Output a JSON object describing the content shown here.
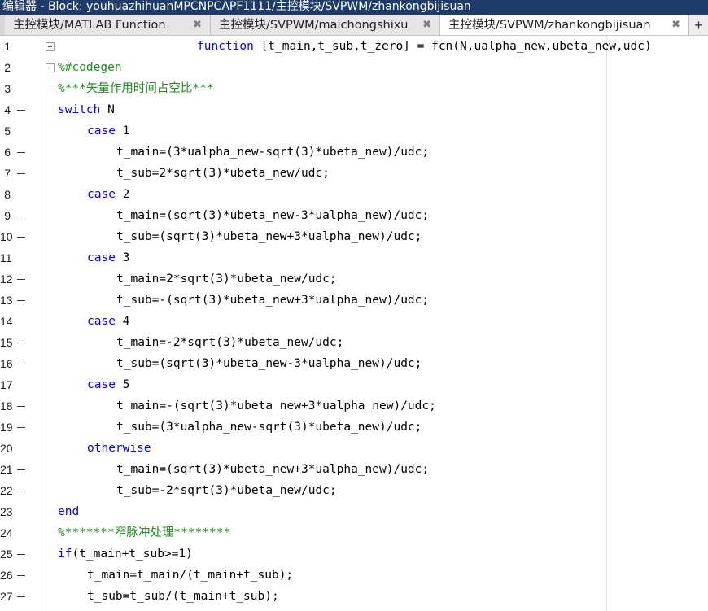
{
  "window": {
    "title": "编辑器 - Block: youhuazhihuanMPCNPCAPF1111/主控模块/SVPWM/zhankongbijisuan"
  },
  "tabs": [
    {
      "label": "主控模块/MATLAB Function",
      "close": "✖",
      "active": false
    },
    {
      "label": "主控模块/SVPWM/maichongshixu",
      "close": "✖",
      "active": false
    },
    {
      "label": "主控模块/SVPWM/zhankongbijisuan",
      "close": "✖",
      "active": true
    }
  ],
  "tab_add": "+",
  "colors": {
    "keyword": "#0000ff",
    "comment": "#228b22",
    "text": "#000000",
    "titlebar": "#1f3b6a"
  },
  "lines": [
    {
      "n": "1",
      "indent": 19,
      "dash": false,
      "fold": true,
      "parts": [
        {
          "t": "function",
          "c": "kw"
        },
        {
          "t": " [t_main,t_sub,t_zero] = fcn(N,ualpha_new,ubeta_new,udc)",
          "c": ""
        }
      ]
    },
    {
      "n": "2",
      "indent": 0,
      "dash": false,
      "fold": true,
      "parts": [
        {
          "t": "%#codegen",
          "c": "cm"
        }
      ]
    },
    {
      "n": "3",
      "indent": 0,
      "dash": false,
      "fold": false,
      "tick": true,
      "parts": [
        {
          "t": "%***矢量作用时间占空比***",
          "c": "cm"
        }
      ]
    },
    {
      "n": "4",
      "indent": 0,
      "dash": true,
      "fold": false,
      "parts": [
        {
          "t": "switch",
          "c": "kw"
        },
        {
          "t": " N",
          "c": ""
        }
      ]
    },
    {
      "n": "5",
      "indent": 4,
      "dash": false,
      "fold": false,
      "parts": [
        {
          "t": "case",
          "c": "kw"
        },
        {
          "t": " 1",
          "c": ""
        }
      ]
    },
    {
      "n": "6",
      "indent": 8,
      "dash": true,
      "fold": false,
      "parts": [
        {
          "t": "t_main=(3*ualpha_new-sqrt(3)*ubeta_new)/udc;",
          "c": ""
        }
      ]
    },
    {
      "n": "7",
      "indent": 8,
      "dash": true,
      "fold": false,
      "parts": [
        {
          "t": "t_sub=2*sqrt(3)*ubeta_new/udc;",
          "c": ""
        }
      ]
    },
    {
      "n": "8",
      "indent": 4,
      "dash": false,
      "fold": false,
      "parts": [
        {
          "t": "case",
          "c": "kw"
        },
        {
          "t": " 2",
          "c": ""
        }
      ]
    },
    {
      "n": "9",
      "indent": 8,
      "dash": true,
      "fold": false,
      "parts": [
        {
          "t": "t_main=(sqrt(3)*ubeta_new-3*ualpha_new)/udc;",
          "c": ""
        }
      ]
    },
    {
      "n": "10",
      "indent": 8,
      "dash": true,
      "fold": false,
      "parts": [
        {
          "t": "t_sub=(sqrt(3)*ubeta_new+3*ualpha_new)/udc;",
          "c": ""
        }
      ]
    },
    {
      "n": "11",
      "indent": 4,
      "dash": false,
      "fold": false,
      "parts": [
        {
          "t": "case",
          "c": "kw"
        },
        {
          "t": " 3",
          "c": ""
        }
      ]
    },
    {
      "n": "12",
      "indent": 8,
      "dash": true,
      "fold": false,
      "parts": [
        {
          "t": "t_main=2*sqrt(3)*ubeta_new/udc;",
          "c": ""
        }
      ]
    },
    {
      "n": "13",
      "indent": 8,
      "dash": true,
      "fold": false,
      "parts": [
        {
          "t": "t_sub=-(sqrt(3)*ubeta_new+3*ualpha_new)/udc;",
          "c": ""
        }
      ]
    },
    {
      "n": "14",
      "indent": 4,
      "dash": false,
      "fold": false,
      "parts": [
        {
          "t": "case",
          "c": "kw"
        },
        {
          "t": " 4",
          "c": ""
        }
      ]
    },
    {
      "n": "15",
      "indent": 8,
      "dash": true,
      "fold": false,
      "parts": [
        {
          "t": "t_main=-2*sqrt(3)*ubeta_new/udc;",
          "c": ""
        }
      ]
    },
    {
      "n": "16",
      "indent": 8,
      "dash": true,
      "fold": false,
      "parts": [
        {
          "t": "t_sub=(sqrt(3)*ubeta_new-3*ualpha_new)/udc;",
          "c": ""
        }
      ]
    },
    {
      "n": "17",
      "indent": 4,
      "dash": false,
      "fold": false,
      "parts": [
        {
          "t": "case",
          "c": "kw"
        },
        {
          "t": " 5",
          "c": ""
        }
      ]
    },
    {
      "n": "18",
      "indent": 8,
      "dash": true,
      "fold": false,
      "parts": [
        {
          "t": "t_main=-(sqrt(3)*ubeta_new+3*ualpha_new)/udc;",
          "c": ""
        }
      ]
    },
    {
      "n": "19",
      "indent": 8,
      "dash": true,
      "fold": false,
      "parts": [
        {
          "t": "t_sub=(3*ualpha_new-sqrt(3)*ubeta_new)/udc;",
          "c": ""
        }
      ]
    },
    {
      "n": "20",
      "indent": 4,
      "dash": false,
      "fold": false,
      "parts": [
        {
          "t": "otherwise",
          "c": "kw"
        }
      ]
    },
    {
      "n": "21",
      "indent": 8,
      "dash": true,
      "fold": false,
      "parts": [
        {
          "t": "t_main=(sqrt(3)*ubeta_new+3*ualpha_new)/udc;",
          "c": ""
        }
      ]
    },
    {
      "n": "22",
      "indent": 8,
      "dash": true,
      "fold": false,
      "parts": [
        {
          "t": "t_sub=-2*sqrt(3)*ubeta_new/udc;",
          "c": ""
        }
      ]
    },
    {
      "n": "23",
      "indent": 0,
      "dash": false,
      "fold": false,
      "parts": [
        {
          "t": "end",
          "c": "kw"
        }
      ]
    },
    {
      "n": "24",
      "indent": 0,
      "dash": false,
      "fold": false,
      "parts": [
        {
          "t": "%*******窄脉冲处理********",
          "c": "cm"
        }
      ]
    },
    {
      "n": "25",
      "indent": 0,
      "dash": true,
      "fold": false,
      "parts": [
        {
          "t": "if",
          "c": "kw"
        },
        {
          "t": "(t_main+t_sub>=1)",
          "c": ""
        }
      ]
    },
    {
      "n": "26",
      "indent": 4,
      "dash": true,
      "fold": false,
      "parts": [
        {
          "t": "t_main=t_main/(t_main+t_sub);",
          "c": ""
        }
      ]
    },
    {
      "n": "27",
      "indent": 4,
      "dash": true,
      "fold": false,
      "parts": [
        {
          "t": "t_sub=t_sub/(t_main+t_sub);",
          "c": ""
        }
      ]
    }
  ]
}
